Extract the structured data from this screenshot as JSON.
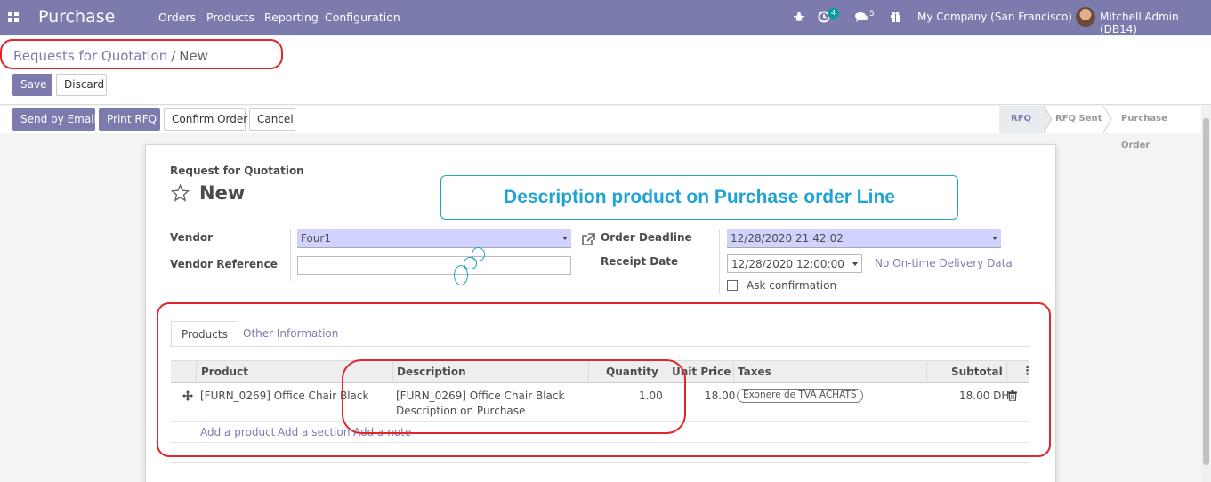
{
  "navbar": {
    "app_title": "Purchase",
    "menu": [
      "Orders",
      "Products",
      "Reporting",
      "Configuration"
    ],
    "activity_count": "4",
    "messages_count": "5",
    "company": "My Company (San Francisco)",
    "user": "Mitchell Admin (DB14)"
  },
  "breadcrumb": {
    "parent": "Requests for Quotation",
    "separator": "/",
    "current": "New"
  },
  "actions": {
    "save": "Save",
    "discard": "Discard"
  },
  "header_buttons": {
    "send_email": "Send by Email",
    "print_rfq": "Print RFQ",
    "confirm_order": "Confirm Order",
    "cancel": "Cancel"
  },
  "statusbar": {
    "stages": [
      "RFQ",
      "RFQ Sent",
      "Purchase Order"
    ],
    "active_stage": "RFQ"
  },
  "form": {
    "doc_type": "Request for Quotation",
    "doc_name": "New",
    "vendor_label": "Vendor",
    "vendor_value": "Four1",
    "vendor_ref_label": "Vendor Reference",
    "vendor_ref_value": "",
    "order_deadline_label": "Order Deadline",
    "order_deadline_value": "12/28/2020 21:42:02",
    "receipt_date_label": "Receipt Date",
    "receipt_date_value": "12/28/2020 12:00:00",
    "ontime_text": "No On-time Delivery Data",
    "ask_confirmation_label": "Ask confirmation"
  },
  "annotation": {
    "callout_text": "Description product on Purchase order Line"
  },
  "tabs": [
    "Products",
    "Other Information"
  ],
  "order_lines": {
    "columns": [
      "Product",
      "Description",
      "Quantity",
      "Unit Price",
      "Taxes",
      "Subtotal"
    ],
    "rows": [
      {
        "product": "[FURN_0269] Office Chair Black",
        "description_line1": "[FURN_0269] Office Chair Black",
        "description_line2": "Description on Purchase",
        "quantity": "1.00",
        "unit_price": "18.00",
        "taxes": "Exonere de TVA ACHATS",
        "subtotal": "18.00 DH"
      }
    ],
    "add_links": [
      "Add a product",
      "Add a section",
      "Add a note"
    ]
  },
  "colors": {
    "brand": "#7c7bad",
    "annotation_red": "#e0252b",
    "callout_blue": "#21a3c4"
  }
}
